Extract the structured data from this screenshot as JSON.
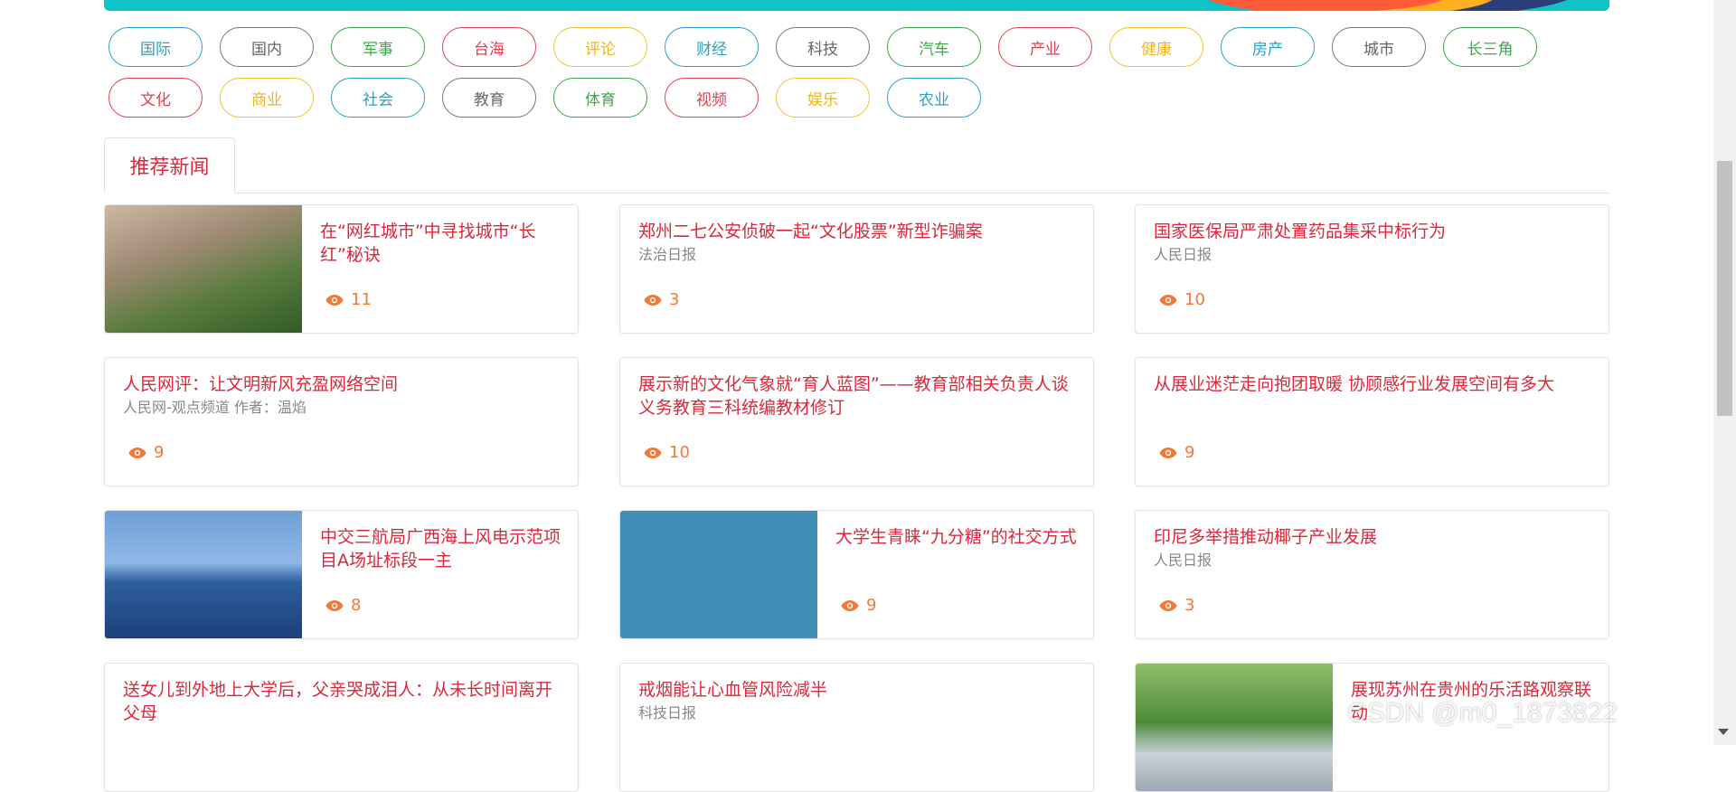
{
  "tags": [
    {
      "label": "国际",
      "color": "blue"
    },
    {
      "label": "国内",
      "color": "gray"
    },
    {
      "label": "军事",
      "color": "green"
    },
    {
      "label": "台海",
      "color": "red"
    },
    {
      "label": "评论",
      "color": "yellow"
    },
    {
      "label": "财经",
      "color": "blue"
    },
    {
      "label": "科技",
      "color": "gray"
    },
    {
      "label": "汽车",
      "color": "green"
    },
    {
      "label": "产业",
      "color": "red"
    },
    {
      "label": "健康",
      "color": "yellow"
    },
    {
      "label": "房产",
      "color": "blue"
    },
    {
      "label": "城市",
      "color": "gray"
    },
    {
      "label": "长三角",
      "color": "green"
    },
    {
      "label": "文化",
      "color": "red"
    },
    {
      "label": "商业",
      "color": "yellow"
    },
    {
      "label": "社会",
      "color": "blue"
    },
    {
      "label": "教育",
      "color": "gray"
    },
    {
      "label": "体育",
      "color": "green"
    },
    {
      "label": "视频",
      "color": "red"
    },
    {
      "label": "娱乐",
      "color": "yellow"
    },
    {
      "label": "农业",
      "color": "blue"
    }
  ],
  "section": {
    "tab_label": "推荐新闻"
  },
  "news": [
    {
      "title": "在“网红城市”中寻找城市“长红”秘诀",
      "source": "",
      "views": "11",
      "image": "garden"
    },
    {
      "title": "郑州二七公安侦破一起“文化股票”新型诈骗案",
      "source": "法治日报",
      "views": "3",
      "image": ""
    },
    {
      "title": "国家医保局严肃处置药品集采中标行为",
      "source": "人民日报",
      "views": "10",
      "image": ""
    },
    {
      "title": "人民网评：让文明新风充盈网络空间",
      "source": "人民网-观点频道 作者：温焰",
      "views": "9",
      "image": ""
    },
    {
      "title": "展示新的文化气象就“育人蓝图”——教育部相关负责人谈义务教育三科统编教材修订",
      "source": "",
      "views": "10",
      "image": ""
    },
    {
      "title": "从展业迷茫走向抱团取暖 协顾感行业发展空间有多大",
      "source": "",
      "views": "9",
      "image": ""
    },
    {
      "title": "中交三航局广西海上风电示范项目A场址标段一主",
      "source": "",
      "views": "8",
      "image": "sea"
    },
    {
      "title": "大学生青睐“九分糖”的社交方式",
      "source": "",
      "views": "9",
      "image": "illus"
    },
    {
      "title": "印尼多举措推动椰子产业发展",
      "source": "人民日报",
      "views": "3",
      "image": ""
    },
    {
      "title": "送女儿到外地上大学后，父亲哭成泪人：从未长时间离开父母",
      "source": "",
      "views": "",
      "image": ""
    },
    {
      "title": "戒烟能让心血管风险减半",
      "source": "科技日报",
      "views": "",
      "image": ""
    },
    {
      "title": "展现苏州在贵州的乐活路观察联动",
      "source": "",
      "views": "",
      "image": "campus"
    }
  ],
  "watermark": "CSDN @m0_1873822",
  "colors": {
    "accent_red": "#d9293a",
    "views_orange": "#f07a3a",
    "banner_teal": "#11c2c6"
  }
}
